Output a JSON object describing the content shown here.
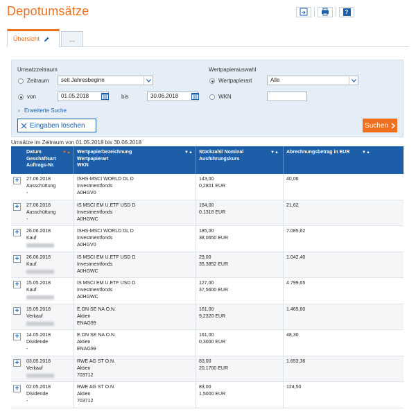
{
  "page": {
    "title": "Depotumsätze"
  },
  "toolbar": {
    "items": [
      {
        "name": "export-csv-icon"
      },
      {
        "name": "print-icon"
      },
      {
        "name": "help-icon",
        "label": "?"
      }
    ]
  },
  "tabs": [
    {
      "label": "Übersicht",
      "active": true
    },
    {
      "label": "...",
      "active": false
    }
  ],
  "filter": {
    "umsatzzeitraum_label": "Umsatzzeitraum",
    "zeitraum_label": "Zeitraum",
    "zeitraum_value": "seit Jahresbeginn",
    "von_label": "von",
    "von_value": "01.05.2018",
    "bis_label": "bis",
    "bis_value": "30.06.2018",
    "wertpapierauswahl_label": "Wertpapierauswahl",
    "wertpapierart_label": "Wertpapierart",
    "wertpapierart_value": "Alle",
    "wkn_label": "WKN",
    "wkn_value": "",
    "erweiterte_suche": "Erweiterte Suche",
    "clear_label": "Eingaben löschen",
    "search_label": "Suchen"
  },
  "period_text": "Umsätze im Zeitraum von 01.05.2018 bis 30.06.2018",
  "table": {
    "headers": {
      "col1": [
        "Datum",
        "Geschäftsart",
        "Auftrags-Nr."
      ],
      "col2": [
        "Wertpapierbezeichnung",
        "Wertpapierart",
        "WKN"
      ],
      "col3": [
        "Stückzahl/ Nominal",
        "Ausführungskurs"
      ],
      "col4": [
        "Abrechnungsbetrag in EUR"
      ]
    },
    "rows": [
      {
        "datum": "27.06.2018",
        "art": "Ausschüttung",
        "auftrag": "-",
        "bez": "ISHS-MSCI WORLD DL D",
        "wpart": "Investmentfonds",
        "wkn": "A0HGV0",
        "stueck": "143,00",
        "kurs": "0,2801 EUR",
        "betrag": "40,06",
        "blur": false
      },
      {
        "datum": "27.06.2018",
        "art": "Ausschüttung",
        "auftrag": "-",
        "bez": "IS MSCI EM U.ETF USD D",
        "wpart": "Investmentfonds",
        "wkn": "A0HGWC",
        "stueck": "164,00",
        "kurs": "0,1318 EUR",
        "betrag": "21,62",
        "blur": false
      },
      {
        "datum": "26.06.2018",
        "art": "Kauf",
        "auftrag": "",
        "bez": "ISHS-MSCI WORLD DL D",
        "wpart": "Investmentfonds",
        "wkn": "A0HGV0",
        "stueck": "185,00",
        "kurs": "38,0650 EUR",
        "betrag": "7.085,62",
        "blur": true
      },
      {
        "datum": "26.06.2018",
        "art": "Kauf",
        "auftrag": "",
        "bez": "IS MSCI EM U.ETF USD D",
        "wpart": "Investmentfonds",
        "wkn": "A0HGWC",
        "stueck": "29,00",
        "kurs": "35,3852 EUR",
        "betrag": "1.042,40",
        "blur": true
      },
      {
        "datum": "15.05.2018",
        "art": "Kauf",
        "auftrag": "",
        "bez": "IS MSCI EM U.ETF USD D",
        "wpart": "Investmentfonds",
        "wkn": "A0HGWC",
        "stueck": "127,00",
        "kurs": "37,5600 EUR",
        "betrag": "4.799,65",
        "blur": true
      },
      {
        "datum": "15.05.2018",
        "art": "Verkauf",
        "auftrag": "",
        "bez": "E.ON SE NA O.N.",
        "wpart": "Aktien",
        "wkn": "ENAG99",
        "stueck": "161,00",
        "kurs": "9,2320 EUR",
        "betrag": "1.465,60",
        "blur": true
      },
      {
        "datum": "14.05.2018",
        "art": "Dividende",
        "auftrag": "-",
        "bez": "E.ON SE NA O.N.",
        "wpart": "Aktien",
        "wkn": "ENAG99",
        "stueck": "161,00",
        "kurs": "0,3000 EUR",
        "betrag": "48,30",
        "blur": false
      },
      {
        "datum": "03.05.2018",
        "art": "Verkauf",
        "auftrag": "",
        "bez": "RWE AG ST O.N.",
        "wpart": "Aktien",
        "wkn": "703712",
        "stueck": "83,00",
        "kurs": "20,1700 EUR",
        "betrag": "1.653,36",
        "blur": true
      },
      {
        "datum": "02.05.2018",
        "art": "Dividende",
        "auftrag": "-",
        "bez": "RWE AG ST O.N.",
        "wpart": "Aktien",
        "wkn": "703712",
        "stueck": "83,00",
        "kurs": "1,5000 EUR",
        "betrag": "124,50",
        "blur": false
      }
    ]
  },
  "colors": {
    "accent": "#ee6f1f",
    "header_blue": "#1c5ea8",
    "filter_bg": "#e5eef6"
  }
}
